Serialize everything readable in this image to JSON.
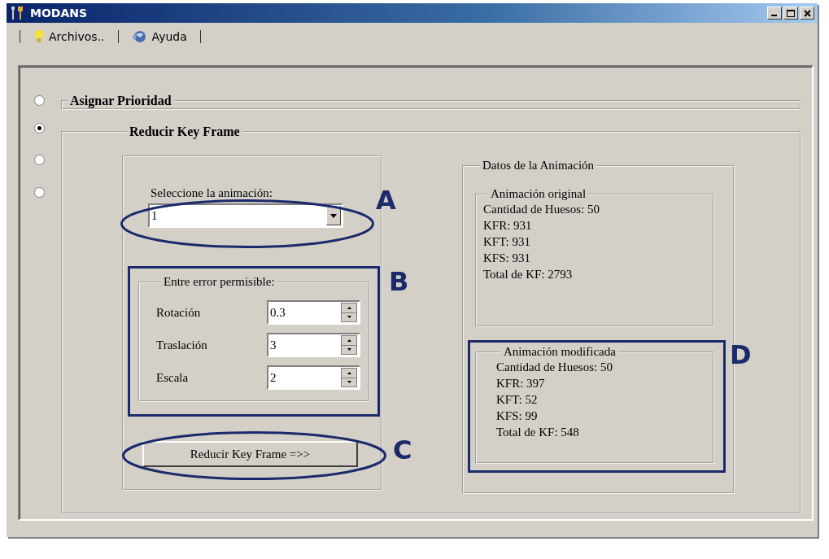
{
  "window": {
    "title": "MODANS"
  },
  "menu": [
    {
      "label": "Archivos.."
    },
    {
      "label": "Ayuda"
    }
  ],
  "modes": [
    {
      "label": "Asignar Prioridad",
      "selected": false
    },
    {
      "label": "Reducir Key Frame",
      "selected": true
    },
    {
      "selected": false
    },
    {
      "selected": false
    }
  ],
  "reduce": {
    "select_label": "Seleccione la animación:",
    "animation": "1",
    "tolerance": {
      "title": "Entre error permisible:",
      "rows": [
        {
          "label": "Rotación",
          "value": "0.3"
        },
        {
          "label": "Traslación",
          "value": "3"
        },
        {
          "label": "Escala",
          "value": "2"
        }
      ]
    },
    "button": "Reducir Key Frame =>>"
  },
  "data": {
    "title": "Datos de la Animación",
    "groups": [
      {
        "title": "Animación original",
        "lines": [
          "Cantidad de Huesos: 50",
          "KFR: 931",
          "KFT: 931",
          "KFS: 931",
          "Total de KF: 2793"
        ]
      },
      {
        "title": "Animación modificada",
        "lines": [
          "Cantidad de Huesos: 50",
          "KFR: 397",
          "KFT: 52",
          "KFS: 99",
          "Total de KF: 548"
        ]
      }
    ]
  },
  "annotations": [
    {
      "kind": "ellipse",
      "label": "A"
    },
    {
      "kind": "rect",
      "label": "B"
    },
    {
      "kind": "ellipse",
      "label": "C"
    },
    {
      "kind": "rect",
      "label": "D"
    }
  ]
}
